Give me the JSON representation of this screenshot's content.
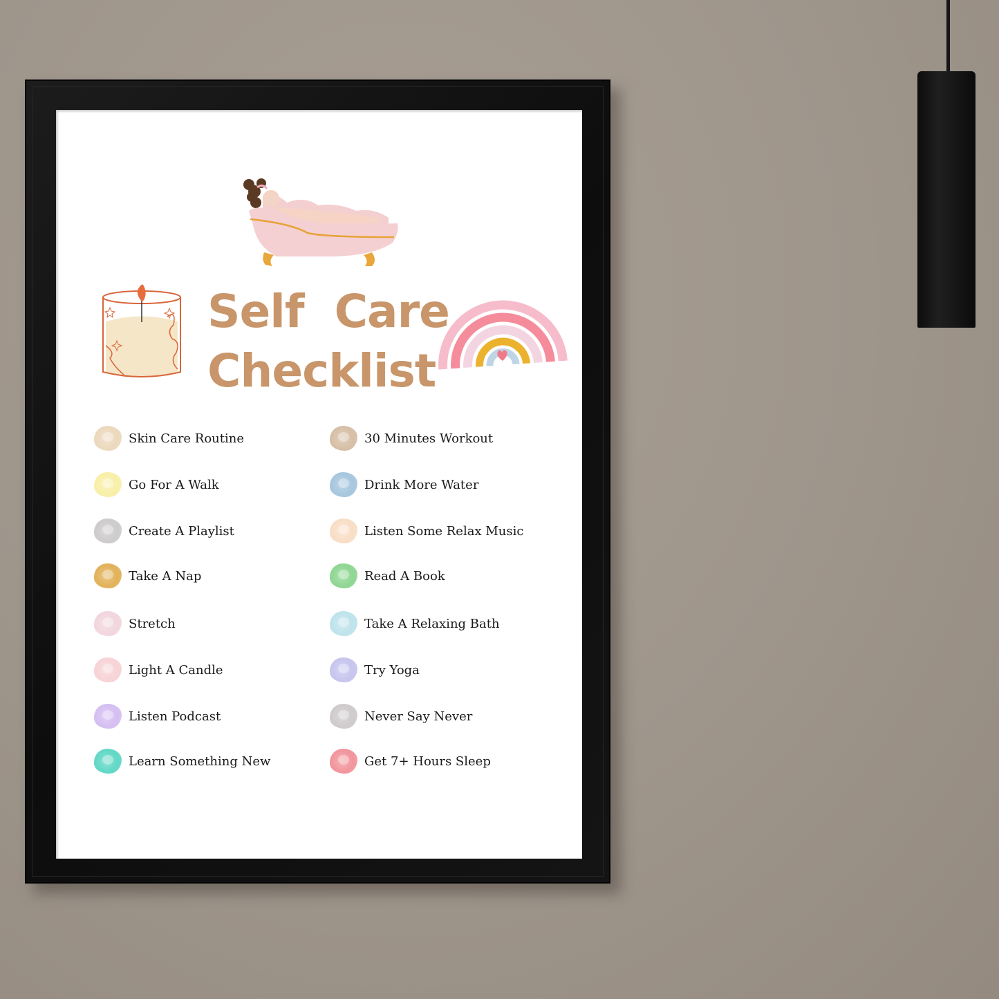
{
  "scene": {
    "wall_color": "#9e958b",
    "frame_color": "#111111",
    "lamp_color": "#141414"
  },
  "poster": {
    "title_line1": "Self  Care",
    "title_line2": "Checklist",
    "title_color": "#c8966a",
    "illustrations": [
      "bathtub-illustration",
      "candle-illustration",
      "rainbow-illustration"
    ],
    "left_column": [
      {
        "label": "Skin Care Routine",
        "color": "#ecd9bd"
      },
      {
        "label": "Go For A Walk",
        "color": "#f8efa8"
      },
      {
        "label": "Create A Playlist",
        "color": "#cdcbcb"
      },
      {
        "label": "Take A Nap",
        "color": "#e2b25a"
      },
      {
        "label": "Stretch",
        "color": "#f2d6de"
      },
      {
        "label": "Light A Candle",
        "color": "#f7d3d6"
      },
      {
        "label": "Listen Podcast",
        "color": "#d5bff2"
      },
      {
        "label": "Learn Something New",
        "color": "#62d8c6"
      }
    ],
    "right_column": [
      {
        "label": "30 Minutes Workout",
        "color": "#d6bfa6"
      },
      {
        "label": "Drink More Water",
        "color": "#a7c6de"
      },
      {
        "label": "Listen Some Relax Music",
        "color": "#f8dec6"
      },
      {
        "label": "Read A Book",
        "color": "#8fd693"
      },
      {
        "label": "Take A Relaxing Bath",
        "color": "#bfe3ec"
      },
      {
        "label": "Try Yoga",
        "color": "#c8c5ee"
      },
      {
        "label": "Never Say Never",
        "color": "#cfcbcd"
      },
      {
        "label": "Get 7+ Hours Sleep",
        "color": "#f2959d"
      }
    ]
  }
}
